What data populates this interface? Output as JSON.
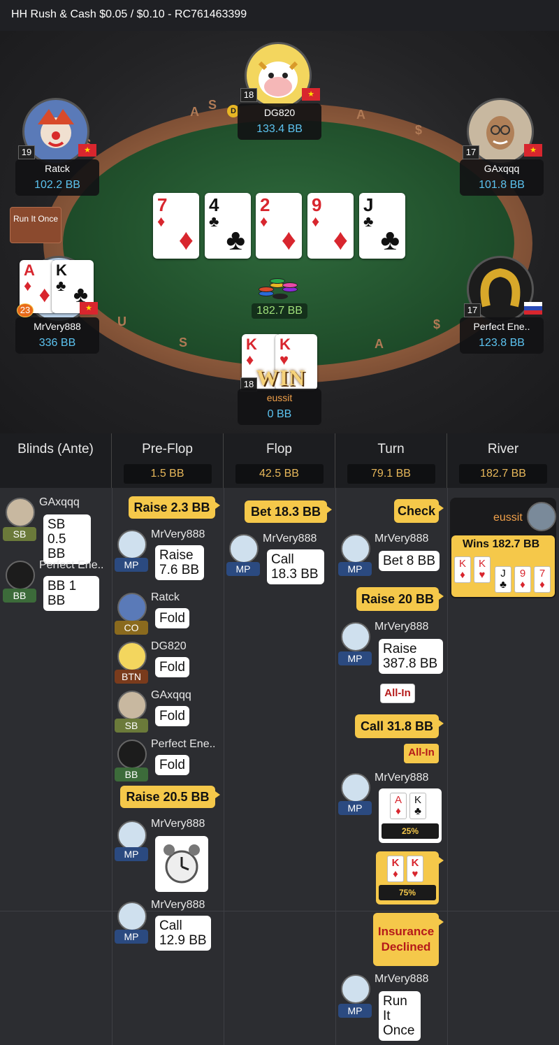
{
  "header": {
    "title": "HH  Rush & Cash $0.05 / $0.10   - RC761463399"
  },
  "table": {
    "run_it_once": "Run It Once",
    "dealer_label": "D",
    "pot": "182.7 BB",
    "board": [
      {
        "rank": "7",
        "suit": "♦",
        "color": "red"
      },
      {
        "rank": "4",
        "suit": "♣",
        "color": "black"
      },
      {
        "rank": "2",
        "suit": "♦",
        "color": "red"
      },
      {
        "rank": "9",
        "suit": "♦",
        "color": "red"
      },
      {
        "rank": "J",
        "suit": "♣",
        "color": "black"
      }
    ],
    "rail_letters": [
      "A",
      "S",
      "A",
      "$",
      "$",
      "U",
      "S",
      "A",
      "$"
    ],
    "win_text": "WIN",
    "seats": {
      "top": {
        "name": "DG820",
        "stack": "133.4 BB",
        "level": "18"
      },
      "left_top": {
        "name": "Ratck",
        "stack": "102.2 BB",
        "level": "19"
      },
      "right_top": {
        "name": "GAxqqq",
        "stack": "101.8 BB",
        "level": "17"
      },
      "left_bottom": {
        "name": "MrVery888",
        "stack": "336 BB",
        "level": "23",
        "cards": [
          {
            "rank": "A",
            "suit": "♦",
            "color": "red"
          },
          {
            "rank": "K",
            "suit": "♣",
            "color": "black"
          }
        ]
      },
      "right_bottom": {
        "name": "Perfect Ene..",
        "stack": "123.8 BB",
        "level": "17"
      },
      "hero": {
        "name": "eussit",
        "stack": "0 BB",
        "level": "18",
        "cards": [
          {
            "rank": "K",
            "suit": "♦",
            "color": "red"
          },
          {
            "rank": "K",
            "suit": "♥",
            "color": "red"
          }
        ]
      }
    },
    "flags": {
      "cn": "★",
      "ru": ""
    }
  },
  "history": {
    "columns": [
      {
        "title": "Blinds (Ante)",
        "pot": ""
      },
      {
        "title": "Pre-Flop",
        "pot": "1.5 BB"
      },
      {
        "title": "Flop",
        "pot": "42.5 BB"
      },
      {
        "title": "Turn",
        "pot": "79.1 BB"
      },
      {
        "title": "River",
        "pot": "182.7 BB"
      }
    ],
    "blinds": [
      {
        "name": "GAxqqq",
        "pos": "SB",
        "action": "SB\n0.5 BB"
      },
      {
        "name": "Perfect Ene..",
        "pos": "BB",
        "action": "BB 1 BB"
      }
    ],
    "preflop": {
      "hero_raise": "Raise 2.3 BB",
      "a1": {
        "name": "MrVery888",
        "pos": "MP",
        "action": "Raise\n7.6 BB"
      },
      "a2": {
        "name": "Ratck",
        "pos": "CO",
        "action": "Fold"
      },
      "a3": {
        "name": "DG820",
        "pos": "BTN",
        "action": "Fold"
      },
      "a4": {
        "name": "GAxqqq",
        "pos": "SB",
        "action": "Fold"
      },
      "a5": {
        "name": "Perfect Ene..",
        "pos": "BB",
        "action": "Fold"
      },
      "hero_raise2": "Raise 20.5 BB",
      "a6": {
        "name": "MrVery888",
        "pos": "MP"
      },
      "a7": {
        "name": "MrVery888",
        "pos": "MP",
        "action": "Call\n12.9 BB"
      }
    },
    "flop": {
      "hero_bet": "Bet 18.3 BB",
      "a1": {
        "name": "MrVery888",
        "pos": "MP",
        "action": "Call\n18.3 BB"
      }
    },
    "turn": {
      "hero_check": "Check",
      "a1": {
        "name": "MrVery888",
        "pos": "MP",
        "action": "Bet 8 BB"
      },
      "hero_raise": "Raise 20 BB",
      "a2": {
        "name": "MrVery888",
        "pos": "MP",
        "action": "Raise\n387.8 BB",
        "allin": "All-In"
      },
      "hero_call": "Call 31.8 BB",
      "hero_allin": "All-In",
      "a3": {
        "name": "MrVery888",
        "pos": "MP",
        "equity": "25%",
        "cards": [
          {
            "rank": "A",
            "suit": "♦",
            "color": "red"
          },
          {
            "rank": "K",
            "suit": "♣",
            "color": "black"
          }
        ]
      },
      "hero_equity": "75%",
      "hero_cards": [
        {
          "rank": "K",
          "suit": "♦",
          "color": "red"
        },
        {
          "rank": "K",
          "suit": "♥",
          "color": "red"
        }
      ],
      "insurance": "Insurance Declined",
      "a4": {
        "name": "MrVery888",
        "pos": "MP",
        "action": "Run It\nOnce"
      }
    },
    "river": {
      "winner": "eussit",
      "wins": "Wins 182.7 BB",
      "cards": [
        {
          "rank": "K",
          "suit": "♦",
          "color": "red"
        },
        {
          "rank": "K",
          "suit": "♥",
          "color": "red"
        },
        {
          "rank": "J",
          "suit": "♣",
          "color": "black"
        },
        {
          "rank": "9",
          "suit": "♦",
          "color": "red"
        },
        {
          "rank": "7",
          "suit": "♦",
          "color": "red"
        }
      ]
    }
  }
}
